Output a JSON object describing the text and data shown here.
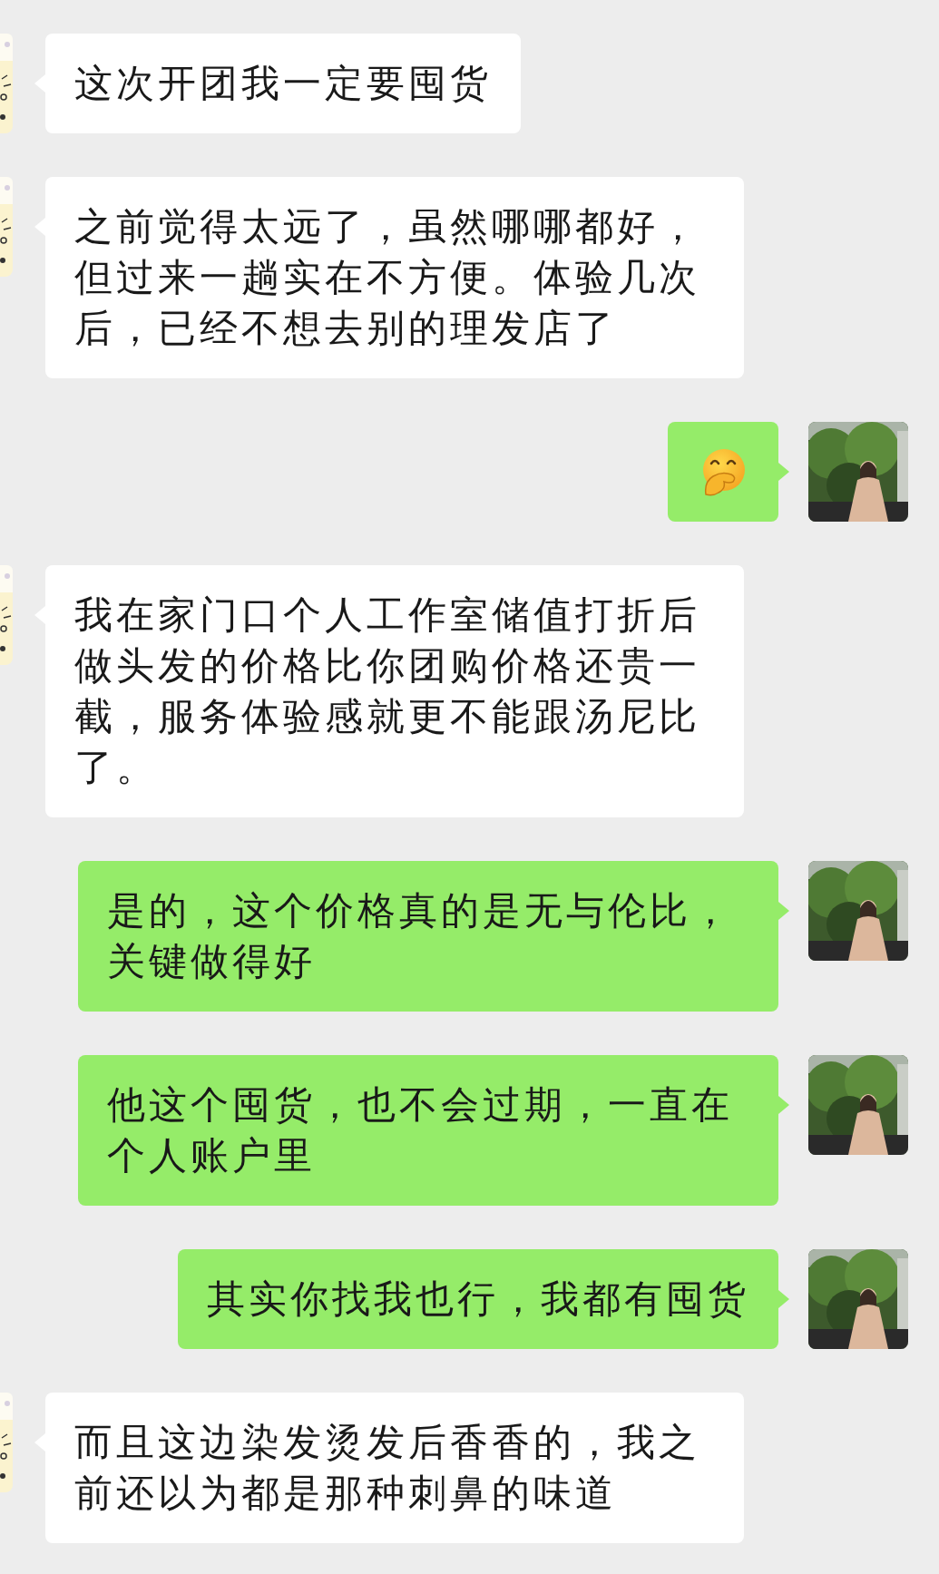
{
  "messages": [
    {
      "outgoing": false,
      "kind": "text",
      "text": "这次开团我一定要囤货"
    },
    {
      "outgoing": false,
      "kind": "text",
      "text": "之前觉得太远了，虽然哪哪都好，但过来一趟实在不方便。体验几次后，已经不想去别的理发店了"
    },
    {
      "outgoing": true,
      "kind": "emoji"
    },
    {
      "outgoing": false,
      "kind": "text",
      "text": "我在家门口个人工作室储值打折后做头发的价格比你团购价格还贵一截，服务体验感就更不能跟汤尼比了。"
    },
    {
      "outgoing": true,
      "kind": "text",
      "text": "是的，这个价格真的是无与伦比，关键做得好"
    },
    {
      "outgoing": true,
      "kind": "text",
      "text": "他这个囤货，也不会过期，一直在个人账户里"
    },
    {
      "outgoing": true,
      "kind": "text",
      "text": "其实你找我也行，我都有囤货"
    },
    {
      "outgoing": false,
      "kind": "text",
      "text": "而且这边染发烫发后香香的，我之前还以为都是那种刺鼻的味道"
    }
  ]
}
